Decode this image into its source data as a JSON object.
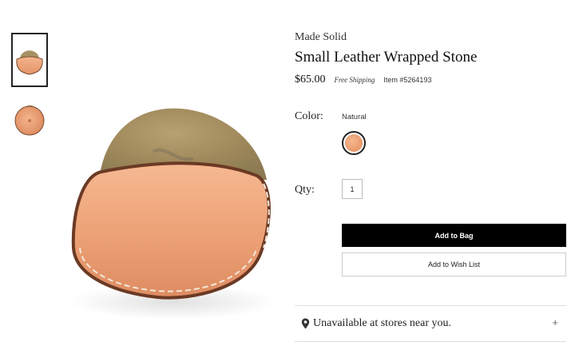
{
  "product": {
    "brand": "Made Solid",
    "title": "Small Leather Wrapped Stone",
    "price": "$65.00",
    "shipping": "Free Shipping",
    "item_number": "Item #5264193"
  },
  "gallery": {
    "thumbnails": [
      {
        "icon": "stone-front-thumbnail",
        "selected": true
      },
      {
        "icon": "stone-back-thumbnail",
        "selected": false
      }
    ],
    "main_image_icon": "leather-wrapped-stone-image"
  },
  "color": {
    "label": "Color:",
    "selected_value": "Natural",
    "swatch_color": "#eba27a"
  },
  "quantity": {
    "label": "Qty:",
    "value": "1"
  },
  "actions": {
    "add_to_bag": "Add to Bag",
    "add_to_wish_list": "Add to Wish List"
  },
  "store_availability": {
    "text": "Unavailable at stores near you.",
    "icon": "map-pin-icon",
    "expand_symbol": "+"
  },
  "colors": {
    "primary_button": "#000000",
    "leather": "#eba27a",
    "text": "#222222"
  }
}
